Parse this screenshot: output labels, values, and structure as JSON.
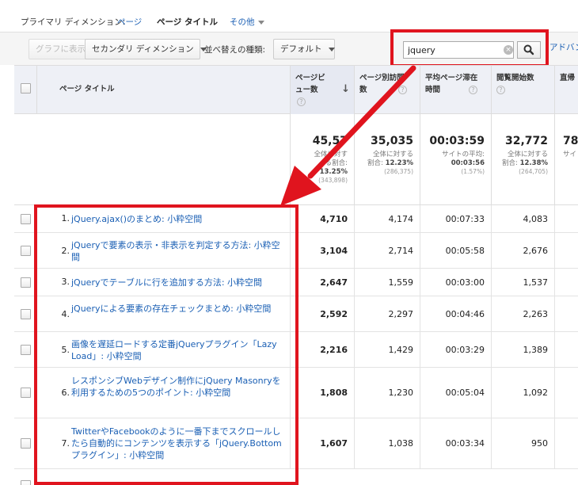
{
  "dimension_bar": {
    "label": "プライマリ ディメンション:",
    "items": [
      {
        "label": "ページ",
        "active": false
      },
      {
        "label": "ページ タイトル",
        "active": true
      },
      {
        "label": "その他",
        "active": false
      }
    ]
  },
  "toolbar": {
    "graph_button": "グラフに表示",
    "secondary_dimension": "セカンダリ ディメンション",
    "sort_label": "並べ替えの種類:",
    "sort_value": "デフォルト",
    "search_value": "jquery",
    "advanced_link": "アドバン"
  },
  "table": {
    "headers": [
      {
        "key": "title",
        "label": "ページ タイトル"
      },
      {
        "key": "pageviews",
        "label": "ページビュー数"
      },
      {
        "key": "unique",
        "label": "ページ別訪問数"
      },
      {
        "key": "avgtime",
        "label": "平均ページ滞在時間"
      },
      {
        "key": "entrances",
        "label": "閲覧開始数"
      },
      {
        "key": "bounce",
        "label": "直帰"
      }
    ],
    "totals": {
      "pageviews": {
        "value": "45,57",
        "sub1": "全体に対す",
        "sub2": "る割合:",
        "pct": "13.25%",
        "base": "(343,898)"
      },
      "unique": {
        "value": "35,035",
        "sub1": "全体に対する",
        "sub2": "割合:",
        "pct": "12.23%",
        "base": "(286,375)"
      },
      "avgtime": {
        "value": "00:03:59",
        "sub1": "サイトの平均:",
        "pct": "00:03:56",
        "base": "(1.57%)"
      },
      "entrances": {
        "value": "32,772",
        "sub1": "全体に対する",
        "sub2": "割合:",
        "pct": "12.38%",
        "base": "(264,705)"
      },
      "bounce": {
        "value": "78",
        "sub1": "サイ"
      }
    },
    "rows": [
      {
        "num": "1.",
        "title": "jQuery.ajax()のまとめ: 小粋空間",
        "pageviews": "4,710",
        "unique": "4,174",
        "avgtime": "00:07:33",
        "entrances": "4,083"
      },
      {
        "num": "2.",
        "title": "jQueryで要素の表示・非表示を判定する方法: 小粋空間",
        "pageviews": "3,104",
        "unique": "2,714",
        "avgtime": "00:05:58",
        "entrances": "2,676"
      },
      {
        "num": "3.",
        "title": "jQueryでテーブルに行を追加する方法: 小粋空間",
        "pageviews": "2,647",
        "unique": "1,559",
        "avgtime": "00:03:00",
        "entrances": "1,537"
      },
      {
        "num": "4.",
        "title": "jQueryによる要素の存在チェックまとめ: 小粋空間",
        "pageviews": "2,592",
        "unique": "2,297",
        "avgtime": "00:04:46",
        "entrances": "2,263"
      },
      {
        "num": "5.",
        "title": "画像を遅延ロードする定番jQueryプラグイン「Lazy Load」: 小粋空間",
        "pageviews": "2,216",
        "unique": "1,429",
        "avgtime": "00:03:29",
        "entrances": "1,389"
      },
      {
        "num": "6.",
        "title": "レスポンシブWebデザイン制作にjQuery Masonryを利用するための5つのポイント: 小粋空間",
        "pageviews": "1,808",
        "unique": "1,230",
        "avgtime": "00:05:04",
        "entrances": "1,092"
      },
      {
        "num": "7.",
        "title": "TwitterやFacebookのように一番下までスクロールしたら自動的にコンテンツを表示する「jQuery.Bottomプラグイン」: 小粋空間",
        "pageviews": "1,607",
        "unique": "1,038",
        "avgtime": "00:03:34",
        "entrances": "950"
      }
    ]
  },
  "colors": {
    "highlight": "#e0141e",
    "link": "#1a5fb4",
    "header_bg": "#eef0f6"
  },
  "icons": [
    "sort-arrow-down-icon",
    "help-icon",
    "search-icon",
    "clear-icon",
    "arrow-icon"
  ]
}
